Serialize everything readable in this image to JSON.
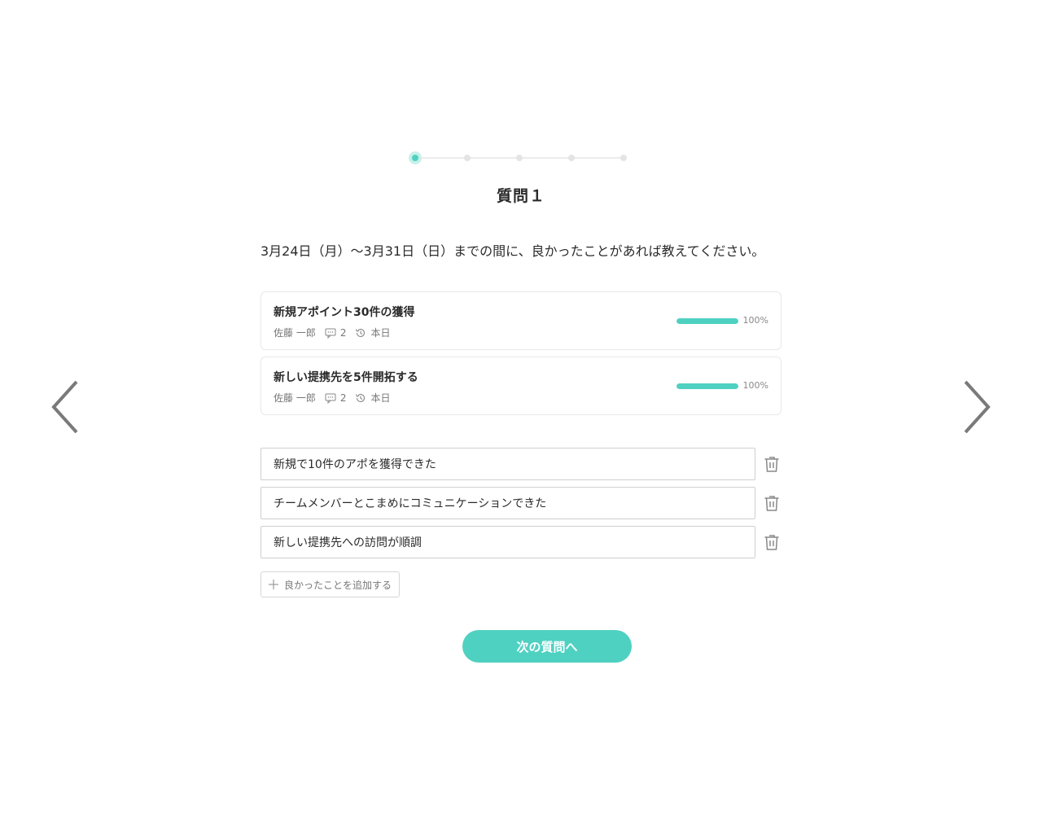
{
  "stepper": {
    "total": 5,
    "current": 1
  },
  "title": "質問１",
  "question": "3月24日（月）〜3月31日（日）までの間に、良かったことがあれば教えてください。",
  "cards": [
    {
      "title": "新規アポイント30件の獲得",
      "owner": "佐藤 一郎",
      "comments": "2",
      "updated": "本日",
      "progress": 1.0,
      "progress_label": "100%"
    },
    {
      "title": "新しい提携先を5件開拓する",
      "owner": "佐藤 一郎",
      "comments": "2",
      "updated": "本日",
      "progress": 1.0,
      "progress_label": "100%"
    }
  ],
  "answers": [
    {
      "value": "新規で10件のアポを獲得できた"
    },
    {
      "value": "チームメンバーとこまめにコミュニケーションできた"
    },
    {
      "value": "新しい提携先への訪問が順調"
    }
  ],
  "add_label": "良かったことを追加する",
  "next_label": "次の質問へ",
  "colors": {
    "accent": "#4fd1c1",
    "accent_light": "#c8f0ea"
  },
  "icons": {
    "prev": "chevron-left-icon",
    "next": "chevron-right-icon",
    "comment": "comment-icon",
    "history": "history-icon",
    "delete": "trash-icon",
    "add": "plus-icon"
  }
}
